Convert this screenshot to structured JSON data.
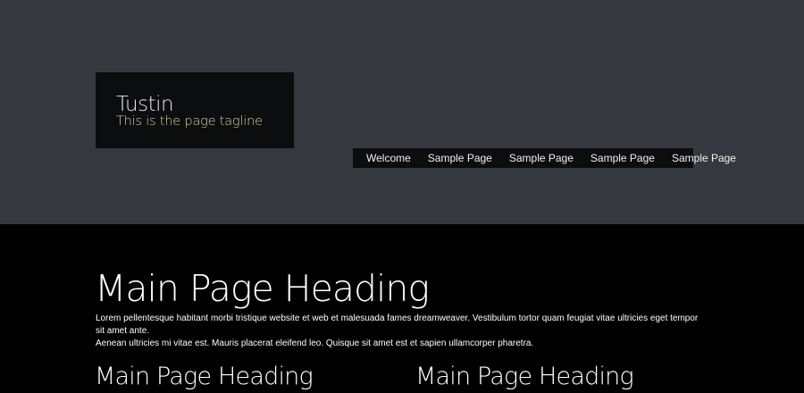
{
  "header": {
    "site_title": "Tustin",
    "tagline": "This is the page tagline"
  },
  "nav": {
    "items": [
      {
        "label": "Welcome"
      },
      {
        "label": "Sample Page"
      },
      {
        "label": "Sample Page"
      },
      {
        "label": "Sample Page"
      },
      {
        "label": "Sample Page"
      }
    ]
  },
  "main": {
    "heading": "Main Page Heading",
    "intro_line1": "Lorem pellentesque habitant morbi tristique website et web et malesuada fames dreamweaver. Vestibulum tortor quam feugiat vitae ultricies eget tempor sit amet ante.",
    "intro_line2": "Aenean ultricies mi vitae est. Mauris placerat eleifend leo. Quisque sit amet est et sapien ullamcorper pharetra.",
    "columns": [
      {
        "heading": "Main Page Heading"
      },
      {
        "heading": "Main Page Heading"
      }
    ]
  }
}
